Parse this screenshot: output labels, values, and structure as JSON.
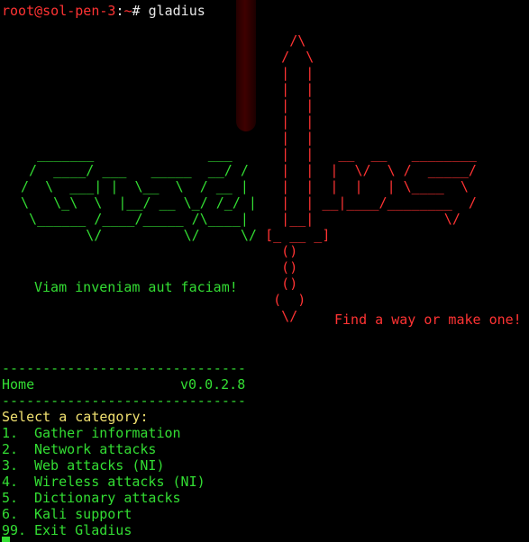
{
  "prompt": {
    "user_host": "root@sol-pen-3",
    "separator": ":",
    "path": "~",
    "symbol": "# ",
    "command": "gladius"
  },
  "banner": {
    "logo_art": "\n\n\n\n\n\n\n   _______              ___\n  /  ____/ ___   _____  __/ /  \n /  \\  ___| |  \\__  \\  / __ |\n \\   \\_\\  \\  |__/ __ \\_/ /_/ |\n  \\______ /____/_____ /\\____|\n         \\/          \\/     \\/",
    "sword_art": "       /\\\n      /  \\\n      |  |\n      |  |\n      |  |\n      |  |\n      |  |\n      |  |   __  __   ________\n      |  |  |  \\/  \\ /  _____/\n      |  |  |  |   | \\____  \\\n      |  | __|____/________  /\n      |__|                \\/\n    [_ __ _]\n      ()\n      ()\n      ()\n     (  )\n      \\/",
    "motto_latin": "Viam inveniam aut faciam!",
    "motto_english": "Find a way or make one!"
  },
  "menu": {
    "separator": "------------------------------",
    "title": "Home",
    "version": "v0.0.2.8",
    "prompt": "Select a category:",
    "items": [
      {
        "num": "1.",
        "label": "Gather information"
      },
      {
        "num": "2.",
        "label": "Network attacks"
      },
      {
        "num": "3.",
        "label": "Web attacks (NI)"
      },
      {
        "num": "4.",
        "label": "Wireless attacks (NI)"
      },
      {
        "num": "5.",
        "label": "Dictionary attacks"
      },
      {
        "num": "6.",
        "label": "Kali support"
      },
      {
        "num": "99.",
        "label": "Exit Gladius"
      }
    ]
  },
  "colors": {
    "background": "#000000",
    "accent_red": "#ff3333",
    "accent_green": "#33dd33",
    "prompt_yellow": "#f0e070"
  }
}
